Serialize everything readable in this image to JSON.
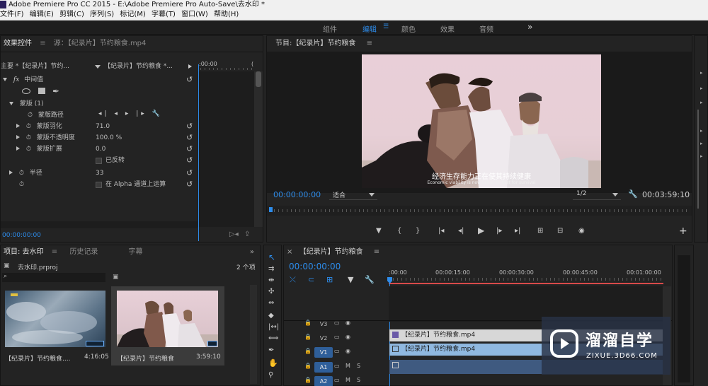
{
  "window": {
    "title": "Adobe Premiere Pro CC 2015 - E:\\Adobe Premiere Pro Auto-Save\\去水印 *"
  },
  "menu": [
    "文件(F)",
    "编辑(E)",
    "剪辑(C)",
    "序列(S)",
    "标记(M)",
    "字幕(T)",
    "窗口(W)",
    "帮助(H)"
  ],
  "workspaces": [
    "组件",
    "编辑",
    "颜色",
    "效果",
    "音频"
  ],
  "workspaces_more": "»",
  "effect_controls": {
    "tab_active": "效果控件",
    "tab_source": "源：【纪录片】节约粮食.mp4",
    "master": "主要 *【纪录片】节约...",
    "sequence": "【纪录片】节约粮食 *...",
    "ruler_time": ":00:00",
    "ruler_time2": "(",
    "fx_label": "fx",
    "fx_name": "中间值",
    "mask_name": "蒙版 (1)",
    "mask_path": "蒙版路径",
    "feather_label": "蒙版羽化",
    "feather_value": "71.0",
    "opacity_label": "蒙版不透明度",
    "opacity_value": "100.0 %",
    "expansion_label": "蒙版扩展",
    "expansion_value": "0.0",
    "inverted_label": "已反转",
    "radius_label": "半径",
    "radius_value": "33",
    "alpha_label": "在 Alpha 通道上运算",
    "timecode": "00:00:00:00"
  },
  "program": {
    "title": "节目:【纪录片】节约粮食",
    "timecode": "00:00:00:00",
    "fit": "适合",
    "resolution": "1/2",
    "duration": "00:03:59:10",
    "subtitle_cn": "经济生存能力正在使其持续健康",
    "subtitle_en": "Economic viability is now linked to that for survival"
  },
  "project": {
    "tabs": [
      "项目: 去水印",
      "历史记录",
      "字幕"
    ],
    "file": "去水印.prproj",
    "count": "2 个项",
    "items": [
      {
        "name": "【纪录片】节约粮食....",
        "duration": "4:16:05"
      },
      {
        "name": "【纪录片】节约粮食",
        "duration": "3:59:10"
      }
    ]
  },
  "timeline": {
    "title": "【纪录片】节约粮食",
    "timecode": "00:00:00:00",
    "ruler": [
      ":00:00",
      "00:00:15:00",
      "00:00:30:00",
      "00:00:45:00",
      "00:01:00:00"
    ],
    "tracks": [
      {
        "name": "V3",
        "kind": "video"
      },
      {
        "name": "V2",
        "kind": "video"
      },
      {
        "name": "V1",
        "kind": "video"
      },
      {
        "name": "A1",
        "kind": "audio",
        "m": "M",
        "s": "S"
      },
      {
        "name": "A2",
        "kind": "audio",
        "m": "M",
        "s": "S"
      }
    ],
    "clip_v2": "【纪录片】节约粮食.mp4",
    "clip_v1": "【纪录片】节约粮食.mp4"
  },
  "watermark": {
    "brand": "溜溜自学",
    "url": "ZIXUE.3D66.COM"
  },
  "colors": {
    "accent": "#2d8ceb",
    "bg": "#232323",
    "clip_video": "#8fb8e0",
    "clip_v2": "#d7d7d7",
    "clip_audio": "#3f5a80",
    "in_out": "#d84a4a"
  }
}
